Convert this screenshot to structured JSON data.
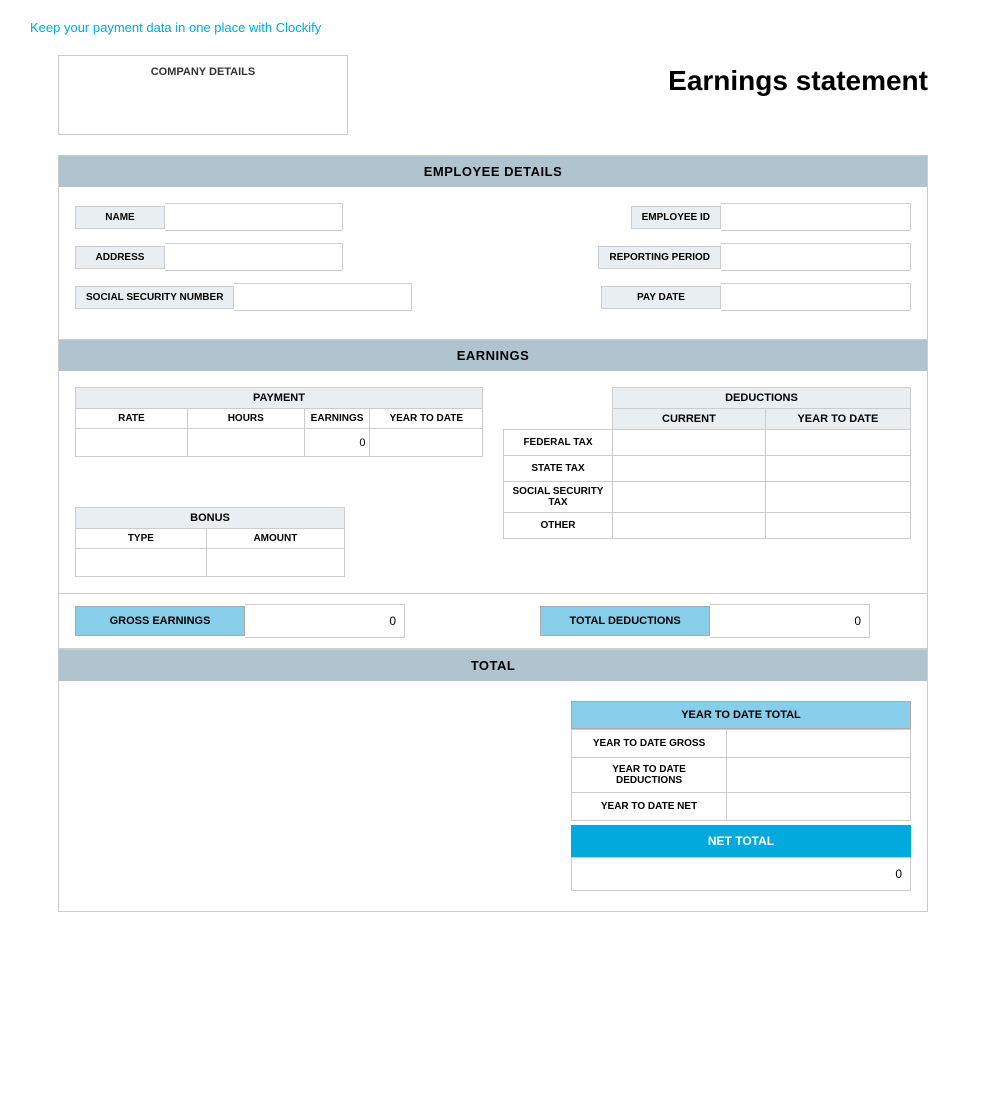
{
  "topLink": {
    "text": "Keep your payment data in one place with Clockify"
  },
  "header": {
    "companyLabel": "COMPANY DETAILS",
    "title": "Earnings statement"
  },
  "employeeDetails": {
    "sectionLabel": "EMPLOYEE DETAILS",
    "fields": {
      "name": "NAME",
      "address": "ADDRESS",
      "socialSecurity": "SOCIAL SECURITY NUMBER",
      "employeeId": "EMPLOYEE ID",
      "reportingPeriod": "REPORTING PERIOD",
      "payDate": "PAY DATE"
    }
  },
  "earnings": {
    "sectionLabel": "EARNINGS",
    "payment": {
      "title": "PAYMENT",
      "columns": [
        "RATE",
        "HOURS",
        "EARNINGS",
        "YEAR TO DATE"
      ],
      "rows": [
        {
          "rate": "",
          "hours": "",
          "earnings": "0",
          "ytd": ""
        }
      ]
    },
    "deductions": {
      "title": "DEDUCTIONS",
      "columns": [
        "CURRENT",
        "YEAR TO DATE"
      ],
      "rows": [
        {
          "label": "FEDERAL TAX"
        },
        {
          "label": "STATE TAX"
        },
        {
          "label": "SOCIAL SECURITY TAX"
        },
        {
          "label": "OTHER"
        }
      ]
    },
    "bonus": {
      "title": "BONUS",
      "columns": [
        "TYPE",
        "AMOUNT"
      ],
      "rows": [
        {
          "type": "",
          "amount": ""
        }
      ]
    },
    "grossEarnings": {
      "label": "GROSS EARNINGS",
      "value": "0"
    },
    "totalDeductions": {
      "label": "TOTAL DEDUCTIONS",
      "value": "0"
    }
  },
  "total": {
    "sectionLabel": "TOTAL",
    "ytdTotal": {
      "header": "YEAR TO DATE TOTAL",
      "rows": [
        {
          "label": "YEAR TO DATE GROSS",
          "value": ""
        },
        {
          "label": "YEAR TO DATE DEDUCTIONS",
          "value": ""
        },
        {
          "label": "YEAR TO DATE NET",
          "value": ""
        }
      ]
    },
    "netTotal": {
      "label": "NET TOTAL",
      "value": "0"
    }
  }
}
